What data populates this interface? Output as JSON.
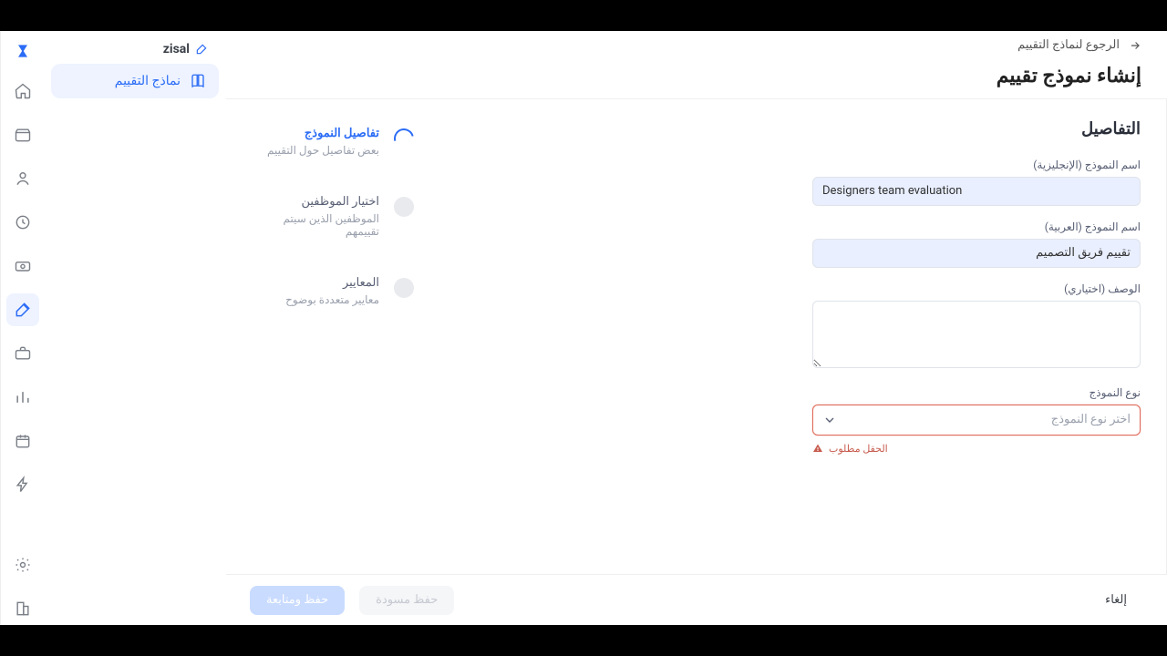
{
  "brand": "zisal",
  "sidebar": {
    "item_label": "نماذج التقييم"
  },
  "header": {
    "back": "الرجوع لنماذج التقييم",
    "title": "إنشاء نموذج تقييم"
  },
  "stepper": [
    {
      "title": "تفاصيل النموذج",
      "subtitle": "بعض تفاصيل حول التقييم"
    },
    {
      "title": "اختيار الموظفين",
      "subtitle": "الموظفين الذين سيتم تقييمهم"
    },
    {
      "title": "المعايير",
      "subtitle": "معايير متعددة بوضوح"
    }
  ],
  "form": {
    "section_title": "التفاصيل",
    "name_en_label": "اسم النموذج (الإنجليزية)",
    "name_en_value": "Designers team evaluation",
    "name_ar_label": "اسم النموذج (العربية)",
    "name_ar_value": "تقييم فريق التصميم",
    "desc_label": "الوصف (اختياري)",
    "type_label": "نوع النموذج",
    "type_placeholder": "اختر نوع النموذج",
    "error": "الحقل مطلوب"
  },
  "footer": {
    "cancel": "إلغاء",
    "draft": "حفظ مسودة",
    "continue": "حفظ ومتابعة"
  }
}
